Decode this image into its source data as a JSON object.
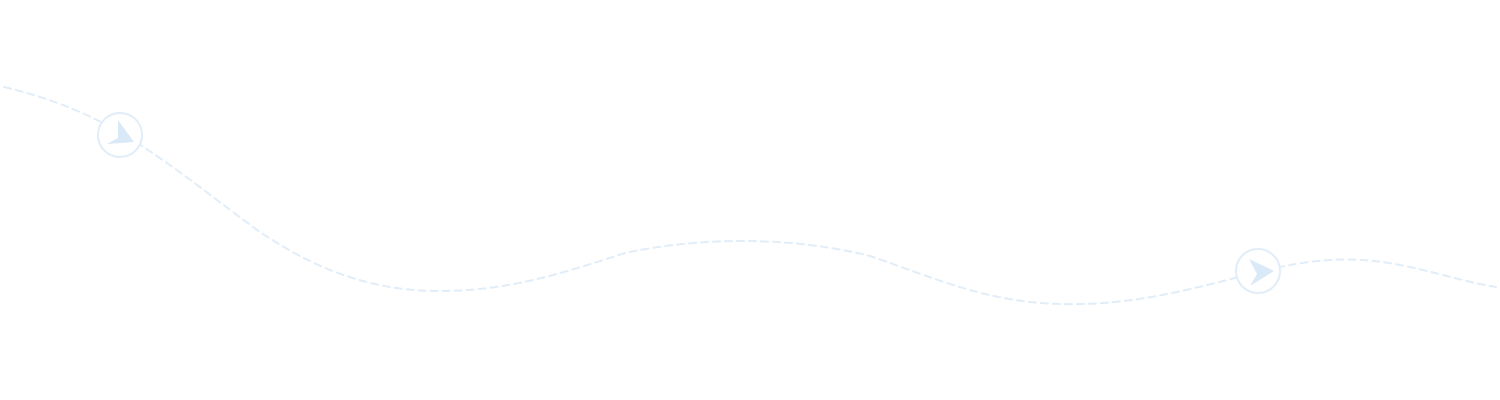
{
  "colors": {
    "background": "#ffffff",
    "route": "#e1edf8",
    "marker_fill": "#ffffff",
    "marker_stroke": "#e1edf8",
    "arrow": "#d9e9f8"
  },
  "icons": {
    "route_line": "dashed-curved-route",
    "start_marker": "paper-plane-icon",
    "end_marker": "paper-plane-icon"
  }
}
